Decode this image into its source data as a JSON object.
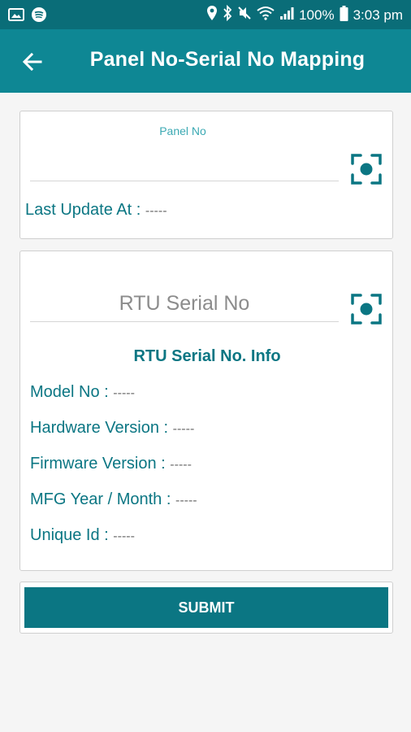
{
  "status_bar": {
    "battery": "100%",
    "time": "3:03 pm",
    "icons_left": [
      "image-icon",
      "spotify-icon"
    ],
    "icons_right": [
      "location-icon",
      "bluetooth-icon",
      "mute-icon",
      "wifi-icon",
      "signal-icon",
      "battery-icon"
    ]
  },
  "header": {
    "title": "Panel No-Serial No Mapping",
    "back_icon": "arrow-back-icon"
  },
  "panel_card": {
    "panel_no_label": "Panel No",
    "panel_no_value": "",
    "last_update_label": "Last Update At :",
    "last_update_value": "-----",
    "scan_icon": "scan-icon"
  },
  "serial_card": {
    "serial_placeholder": "RTU Serial No",
    "scan_icon": "scan-icon",
    "info_title": "RTU Serial No. Info",
    "fields": [
      {
        "label": "Model No :",
        "value": "-----"
      },
      {
        "label": "Hardware Version :",
        "value": "-----"
      },
      {
        "label": "Firmware Version :",
        "value": "-----"
      },
      {
        "label": "MFG Year / Month :",
        "value": "-----"
      },
      {
        "label": "Unique Id :",
        "value": "-----"
      }
    ]
  },
  "actions": {
    "submit_label": "SUBMIT"
  },
  "colors": {
    "status_bar": "#0a6d78",
    "app_bar": "#0e8794",
    "accent": "#0b7683",
    "label_accent": "#3ba9b3",
    "background": "#f5f5f5"
  }
}
